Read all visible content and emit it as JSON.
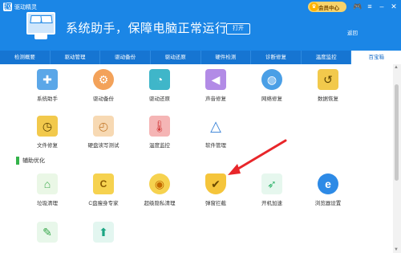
{
  "header": {
    "app_name": "驱动精灵",
    "slogan": "系统助手，保障电脑正常运行",
    "open_label": "打开",
    "back_label": "返回",
    "vip_label": "会员中心",
    "accent": "#1b86e6"
  },
  "tabs": [
    "检测概要",
    "驱动管理",
    "驱动备份",
    "驱动还原",
    "硬件检测",
    "诊断修复",
    "温度监控",
    "百宝箱"
  ],
  "active_tab": "百宝箱",
  "system_tools": [
    {
      "label": "系统助手",
      "icon": "plus-cross-icon"
    },
    {
      "label": "驱动备份",
      "icon": "gear-backup-icon"
    },
    {
      "label": "驱动还原",
      "icon": "clock-restore-icon"
    },
    {
      "label": "声音修复",
      "icon": "speaker-icon"
    },
    {
      "label": "网络修复",
      "icon": "globe-icon"
    },
    {
      "label": "数据恢复",
      "icon": "data-restore-icon"
    },
    {
      "label": "文件修复",
      "icon": "file-restore-icon"
    },
    {
      "label": "硬盘读写测试",
      "icon": "gauge-icon"
    },
    {
      "label": "温度监控",
      "icon": "thermometer-icon"
    },
    {
      "label": "软件管理",
      "icon": "triangle-apps-icon"
    }
  ],
  "section": {
    "title": "辅助优化"
  },
  "optimize_tools": [
    {
      "label": "垃圾清理",
      "icon": "broom-icon"
    },
    {
      "label": "C盘瘦身专家",
      "icon": "disk-c-icon"
    },
    {
      "label": "超级隐私清理",
      "icon": "privacy-disk-icon"
    },
    {
      "label": "弹窗拦截",
      "icon": "shield-check-icon"
    },
    {
      "label": "开机加速",
      "icon": "rocket-icon"
    },
    {
      "label": "浏览器设置",
      "icon": "browser-e-icon"
    },
    {
      "label": "",
      "icon": "edit-note-icon"
    },
    {
      "label": "",
      "icon": "upload-box-icon"
    }
  ]
}
